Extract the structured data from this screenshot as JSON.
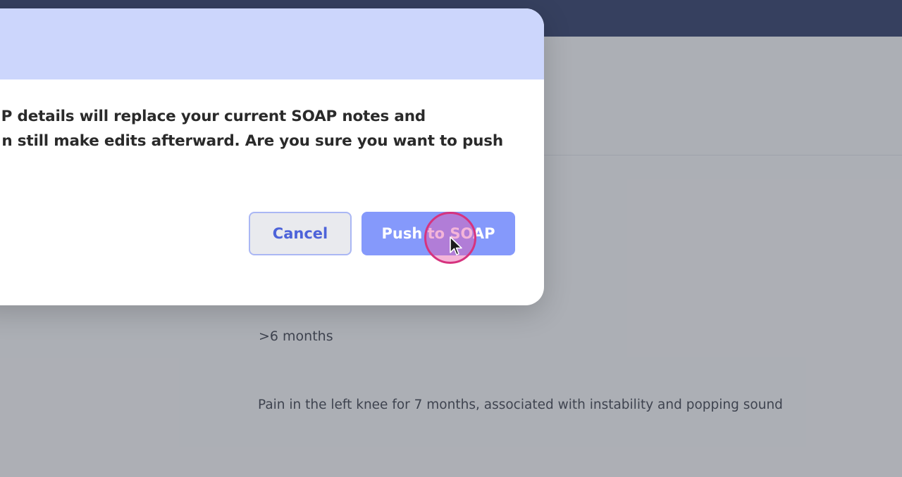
{
  "background": {
    "duration_text": ">6 months",
    "complaint_text": "Pain in the left knee for 7 months, associated with instability and popping sound"
  },
  "modal": {
    "body_line1": "P details will replace your current SOAP notes and",
    "body_line2": "n still make edits afterward. Are you sure you want to push",
    "cancel_label": "Cancel",
    "push_label": "Push to SOAP"
  },
  "colors": {
    "header": "#ccd6fc",
    "primary": "#8599fb",
    "topbar": "#2b3a66",
    "click_indicator": "#d6337e"
  },
  "icons": {
    "cursor": "arrow-cursor-icon",
    "click": "click-indicator"
  }
}
